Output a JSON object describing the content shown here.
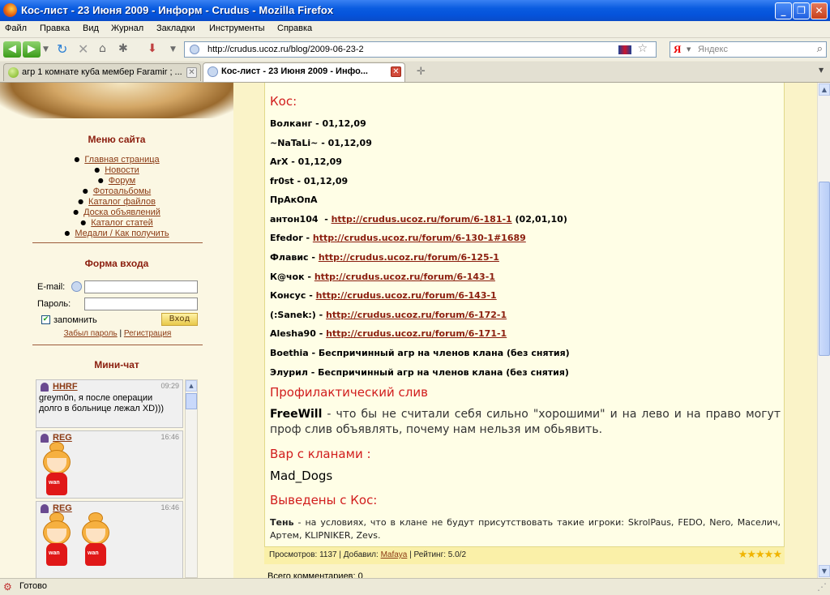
{
  "window": {
    "title": "Кос-лист - 23 Июня 2009 - Информ - Crudus - Mozilla Firefox",
    "controls": [
      "_",
      "❐",
      "✕"
    ]
  },
  "menu": [
    "Файл",
    "Правка",
    "Вид",
    "Журнал",
    "Закладки",
    "Инструменты",
    "Справка"
  ],
  "navigation": {
    "url": "http://crudus.ucoz.ru/blog/2009-06-23-2",
    "search_placeholder": "Яндекс",
    "search_engine_label": "Я"
  },
  "tabs": [
    {
      "label": "агр 1 комнате куба мембер Faramir ; ...",
      "active": false
    },
    {
      "label": "Кос-лист - 23 Июня 2009 - Инфо...",
      "active": true
    }
  ],
  "sidebar": {
    "menu_title": "Меню сайта",
    "menu_items": [
      "Главная страница",
      "Новости",
      "Форум",
      "Фотоальбомы",
      "Каталог файлов",
      "Доска объявлений",
      "Каталог статей",
      "Медали / Как получить"
    ],
    "login_title": "Форма входа",
    "email_label": "E-mail:",
    "password_label": "Пароль:",
    "remember_label": "запомнить",
    "login_button": "Вход",
    "forgot_link": "Забыл пароль",
    "register_link": "Регистрация",
    "link_separator": "|",
    "chat_title": "Мини-чат",
    "chat_messages": [
      {
        "user": "HHRF",
        "time": "09:29",
        "text": "greym0n, я после операции долго в больнице лежал XD)))"
      },
      {
        "user": "REG",
        "time": "16:46",
        "text": ""
      },
      {
        "user": "REG",
        "time": "16:46",
        "text": ""
      }
    ],
    "smiley_caption": "wan"
  },
  "content": {
    "kos_heading": "Кос:",
    "entries": [
      {
        "name": "Волканг",
        "suffix": " - 01,12,09",
        "link": "",
        "after": ""
      },
      {
        "name": "~NaTaLi~",
        "suffix": " - 01,12,09",
        "link": "",
        "after": ""
      },
      {
        "name": "ArX",
        "suffix": " - 01,12,09",
        "link": "",
        "after": ""
      },
      {
        "name": "fr0st",
        "suffix": " - 01,12,09",
        "link": "",
        "after": ""
      },
      {
        "name": "ПрАкОпА",
        "suffix": "",
        "link": "",
        "after": ""
      },
      {
        "name": "антон104",
        "suffix": "  - ",
        "link": "http://crudus.ucoz.ru/forum/6-181-1",
        "after": " (02,01,10)"
      },
      {
        "name": "Efedor",
        "suffix": " - ",
        "link": "http://crudus.ucoz.ru/forum/6-130-1#1689",
        "after": ""
      },
      {
        "name": "Флавис",
        "suffix": " - ",
        "link": "http://crudus.ucoz.ru/forum/6-125-1",
        "after": ""
      },
      {
        "name": "К@чок",
        "suffix": " - ",
        "link": "http://crudus.ucoz.ru/forum/6-143-1",
        "after": ""
      },
      {
        "name": "Консус",
        "suffix": " - ",
        "link": "http://crudus.ucoz.ru/forum/6-143-1",
        "after": ""
      },
      {
        "name": "(:Sanek:)",
        "suffix": " - ",
        "link": "http://crudus.ucoz.ru/forum/6-172-1",
        "after": ""
      },
      {
        "name": "Alesha90",
        "suffix": " - ",
        "link": "http://crudus.ucoz.ru/forum/6-171-1",
        "after": ""
      },
      {
        "name": "Boethia",
        "suffix": " - Беспричинный агр на членов клана (без снятия)",
        "link": "",
        "after": ""
      },
      {
        "name": "Элурил",
        "suffix": " - Беспричинный агр на членов клана (без снятия)",
        "link": "",
        "after": ""
      }
    ],
    "prophylactic_heading": "Профилактический слив",
    "freewill_name": "FreeWill",
    "freewill_text": " - что бы не считали себя сильно \"хорошими\" и на лево и на право могут проф слив объявлять, почему нам нельзя им обьявить.",
    "war_heading": "Вар с кланами :",
    "war_clan": "Mad_Dogs",
    "removed_heading": "Выведены с Кос:",
    "removed_name": "Тень",
    "removed_text": " - на условиях, что в клане не будут присутствовать такие игроки: SkrolPaus, FEDO, Nero, Маселич, Артем, KLIPNIKER, Zevs.",
    "stats_views_label": "Просмотров: 1137 | Добавил: ",
    "stats_author": "Mafaya",
    "stats_rating": " | Рейтинг: 5.0/2",
    "rating_stars": "★★★★★",
    "comments_label": "Всего комментариев: 0"
  },
  "status": {
    "text": "Готово"
  },
  "colors": {
    "page_bg": "#FAF3C8",
    "heading_red": "#D11D1D",
    "link_brown": "#8B1E0E",
    "titlebar_blue": "#0A5CE0"
  }
}
